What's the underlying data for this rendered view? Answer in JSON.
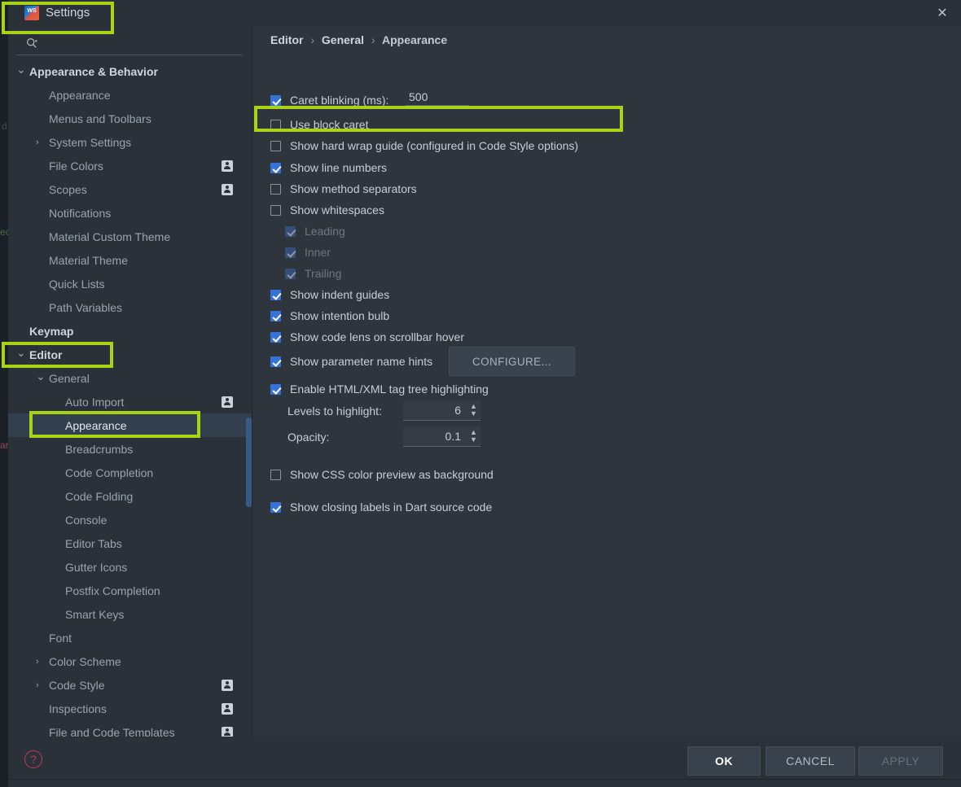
{
  "window": {
    "title": "Settings",
    "app_icon": "webstorm-icon",
    "close_label": "✕"
  },
  "search": {
    "value": "",
    "placeholder": "",
    "icon": "search-icon"
  },
  "breadcrumb": {
    "items": [
      "Editor",
      "General",
      "Appearance"
    ],
    "separator": "›"
  },
  "sidebar": {
    "items": [
      {
        "label": "Appearance & Behavior",
        "indent": 0,
        "arrow": "down",
        "bold": true,
        "badge": false,
        "selected": false
      },
      {
        "label": "Appearance",
        "indent": 1,
        "arrow": "",
        "bold": false,
        "badge": false,
        "selected": false
      },
      {
        "label": "Menus and Toolbars",
        "indent": 1,
        "arrow": "",
        "bold": false,
        "badge": false,
        "selected": false
      },
      {
        "label": "System Settings",
        "indent": 1,
        "arrow": "right",
        "bold": false,
        "badge": false,
        "selected": false
      },
      {
        "label": "File Colors",
        "indent": 1,
        "arrow": "",
        "bold": false,
        "badge": true,
        "selected": false
      },
      {
        "label": "Scopes",
        "indent": 1,
        "arrow": "",
        "bold": false,
        "badge": true,
        "selected": false
      },
      {
        "label": "Notifications",
        "indent": 1,
        "arrow": "",
        "bold": false,
        "badge": false,
        "selected": false
      },
      {
        "label": "Material Custom Theme",
        "indent": 1,
        "arrow": "",
        "bold": false,
        "badge": false,
        "selected": false
      },
      {
        "label": "Material Theme",
        "indent": 1,
        "arrow": "",
        "bold": false,
        "badge": false,
        "selected": false
      },
      {
        "label": "Quick Lists",
        "indent": 1,
        "arrow": "",
        "bold": false,
        "badge": false,
        "selected": false
      },
      {
        "label": "Path Variables",
        "indent": 1,
        "arrow": "",
        "bold": false,
        "badge": false,
        "selected": false
      },
      {
        "label": "Keymap",
        "indent": 0,
        "arrow": "",
        "bold": true,
        "badge": false,
        "selected": false
      },
      {
        "label": "Editor",
        "indent": 0,
        "arrow": "down",
        "bold": true,
        "badge": false,
        "selected": false
      },
      {
        "label": "General",
        "indent": 1,
        "arrow": "down",
        "bold": false,
        "badge": false,
        "selected": false
      },
      {
        "label": "Auto Import",
        "indent": 2,
        "arrow": "",
        "bold": false,
        "badge": true,
        "selected": false
      },
      {
        "label": "Appearance",
        "indent": 2,
        "arrow": "",
        "bold": false,
        "badge": false,
        "selected": true
      },
      {
        "label": "Breadcrumbs",
        "indent": 2,
        "arrow": "",
        "bold": false,
        "badge": false,
        "selected": false
      },
      {
        "label": "Code Completion",
        "indent": 2,
        "arrow": "",
        "bold": false,
        "badge": false,
        "selected": false
      },
      {
        "label": "Code Folding",
        "indent": 2,
        "arrow": "",
        "bold": false,
        "badge": false,
        "selected": false
      },
      {
        "label": "Console",
        "indent": 2,
        "arrow": "",
        "bold": false,
        "badge": false,
        "selected": false
      },
      {
        "label": "Editor Tabs",
        "indent": 2,
        "arrow": "",
        "bold": false,
        "badge": false,
        "selected": false
      },
      {
        "label": "Gutter Icons",
        "indent": 2,
        "arrow": "",
        "bold": false,
        "badge": false,
        "selected": false
      },
      {
        "label": "Postfix Completion",
        "indent": 2,
        "arrow": "",
        "bold": false,
        "badge": false,
        "selected": false
      },
      {
        "label": "Smart Keys",
        "indent": 2,
        "arrow": "",
        "bold": false,
        "badge": false,
        "selected": false
      },
      {
        "label": "Font",
        "indent": 1,
        "arrow": "",
        "bold": false,
        "badge": false,
        "selected": false
      },
      {
        "label": "Color Scheme",
        "indent": 1,
        "arrow": "right",
        "bold": false,
        "badge": false,
        "selected": false
      },
      {
        "label": "Code Style",
        "indent": 1,
        "arrow": "right",
        "bold": false,
        "badge": true,
        "selected": false
      },
      {
        "label": "Inspections",
        "indent": 1,
        "arrow": "",
        "bold": false,
        "badge": true,
        "selected": false
      },
      {
        "label": "File and Code Templates",
        "indent": 1,
        "arrow": "",
        "bold": false,
        "badge": true,
        "selected": false
      }
    ]
  },
  "settings": {
    "caret_blinking_label": "Caret blinking (ms):",
    "caret_blinking_value": "500",
    "options": [
      {
        "label": "Use block caret",
        "state": "unchecked",
        "indent": 0
      },
      {
        "label": "Show hard wrap guide (configured in Code Style options)",
        "state": "unchecked",
        "indent": 0
      },
      {
        "label": "Show line numbers",
        "state": "checked",
        "indent": 0
      },
      {
        "label": "Show method separators",
        "state": "unchecked",
        "indent": 0
      },
      {
        "label": "Show whitespaces",
        "state": "unchecked",
        "indent": 0
      },
      {
        "label": "Leading",
        "state": "disabled-checked",
        "indent": 1
      },
      {
        "label": "Inner",
        "state": "disabled-checked",
        "indent": 1
      },
      {
        "label": "Trailing",
        "state": "disabled-checked",
        "indent": 1
      },
      {
        "label": "Show indent guides",
        "state": "checked",
        "indent": 0
      },
      {
        "label": "Show intention bulb",
        "state": "checked",
        "indent": 0
      },
      {
        "label": "Show code lens on scrollbar hover",
        "state": "checked",
        "indent": 0
      },
      {
        "label": "Show parameter name hints",
        "state": "checked",
        "indent": 0
      },
      {
        "label": "Enable HTML/XML tag tree highlighting",
        "state": "checked",
        "indent": 0
      }
    ],
    "configure_button": "CONFIGURE...",
    "levels_label": "Levels to highlight:",
    "levels_value": "6",
    "opacity_label": "Opacity:",
    "opacity_value": "0.1",
    "css_preview": {
      "label": "Show CSS color preview as background",
      "state": "unchecked"
    },
    "dart_labels": {
      "label": "Show closing labels in Dart source code",
      "state": "checked"
    }
  },
  "footer": {
    "help_icon": "?",
    "ok": "OK",
    "cancel": "CANCEL",
    "apply": "APPLY"
  },
  "colors": {
    "accent_blue": "#3574d6",
    "highlight_green": "#a8d317",
    "panel_bg": "#2f353d",
    "sidebar_bg": "#2b3139",
    "help_red": "#c2385c"
  },
  "background_text": {
    "frag1": "d",
    "frag2": "ec",
    "frag3": "ar"
  }
}
